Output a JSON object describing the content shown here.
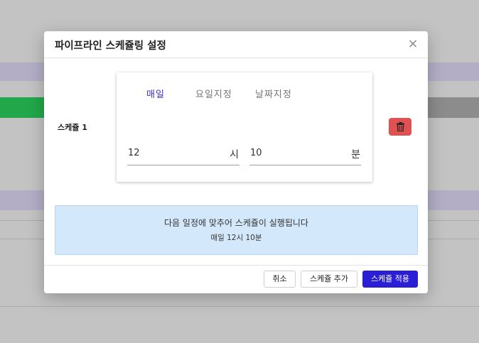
{
  "modal": {
    "title": "파이프라인 스케쥴링 설정",
    "close_symbol": "×"
  },
  "schedule": {
    "label": "스케쥴 1",
    "tabs": [
      {
        "label": "매일",
        "active": true
      },
      {
        "label": "요일지정",
        "active": false
      },
      {
        "label": "날짜지정",
        "active": false
      }
    ],
    "hour": {
      "value": "12",
      "unit": "시"
    },
    "minute": {
      "value": "10",
      "unit": "분"
    },
    "delete_icon": "trash-icon"
  },
  "info": {
    "line1": "다음 일정에 맞추어 스케쥴이 실행됩니다",
    "line2": "매일 12시 10분"
  },
  "footer": {
    "cancel": "취소",
    "add": "스케쥴 추가",
    "apply": "스케쥴 적용"
  },
  "colors": {
    "accent": "#2a1fd4",
    "active_tab": "#3b2fd6",
    "delete": "#e05252",
    "info_bg": "#d4e8fc"
  }
}
